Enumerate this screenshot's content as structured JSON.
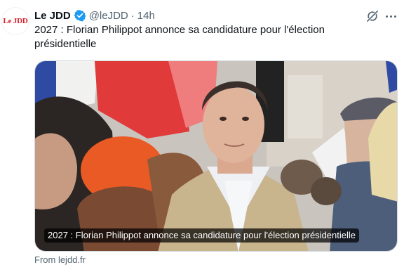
{
  "avatar": {
    "text": "Le JDD"
  },
  "author": {
    "display_name": "Le JDD",
    "handle": "@leJDD",
    "separator": "·",
    "time": "14h"
  },
  "icons": {
    "verified": "verified-badge-icon",
    "grok": "grok-icon",
    "more": "more-options-icon"
  },
  "tweet": {
    "text": "2027 : Florian Philippot annonce sa candidature pour l'élection présidentielle"
  },
  "media": {
    "caption": "2027 : Florian Philippot annonce sa candidature pour l'élection présidentielle"
  },
  "card": {
    "source": "From lejdd.fr"
  },
  "colors": {
    "verified": "#1d9bf0",
    "brand_red": "#d3212b",
    "secondary_text": "#536471"
  }
}
